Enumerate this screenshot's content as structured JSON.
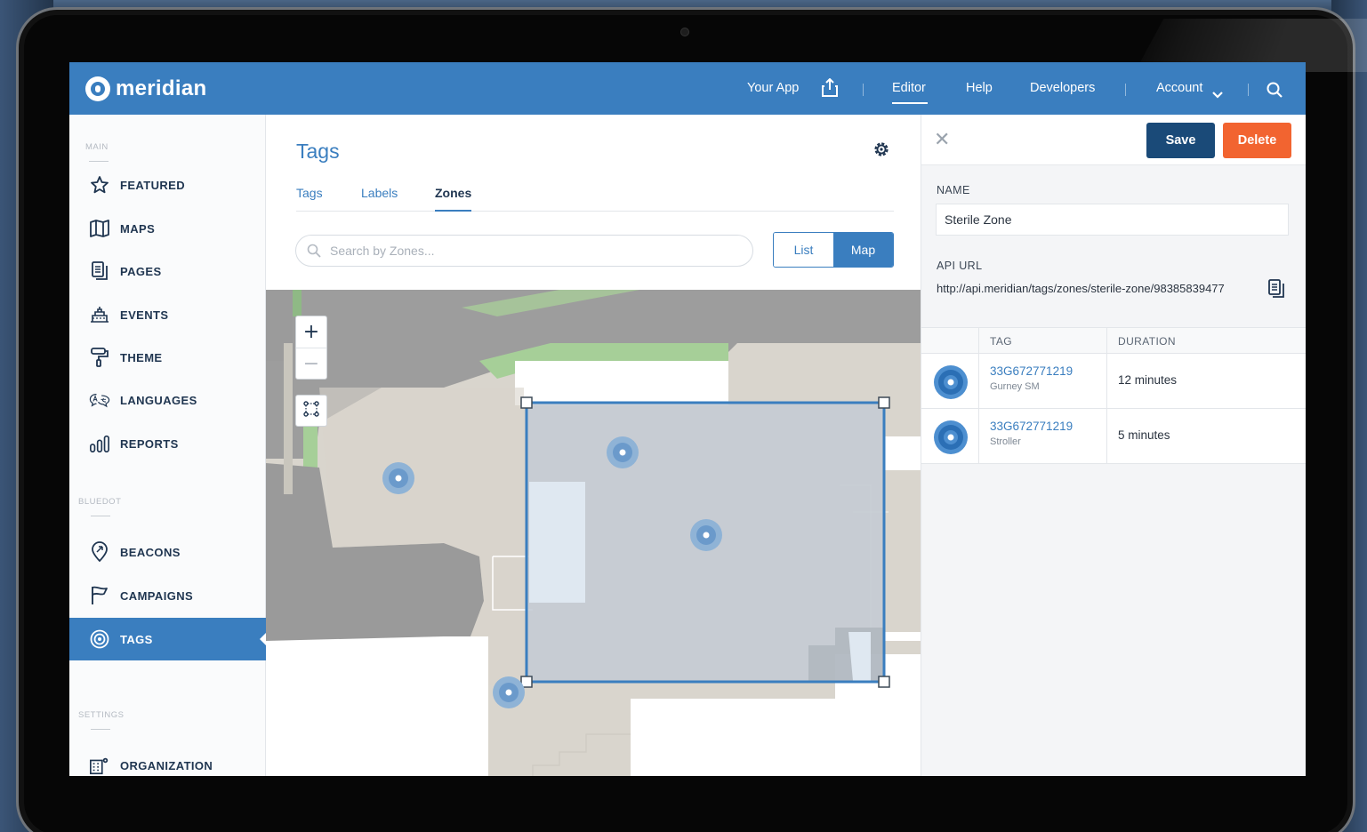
{
  "brand": {
    "name": "meridian"
  },
  "nav": {
    "your_app": "Your App",
    "editor": "Editor",
    "help": "Help",
    "developers": "Developers",
    "account": "Account"
  },
  "sidebar": {
    "sections": {
      "main": "MAIN",
      "bluedot": "BLUEDOT",
      "settings": "SETTINGS"
    },
    "items": [
      {
        "label": "FEATURED",
        "icon": "star-icon"
      },
      {
        "label": "MAPS",
        "icon": "map-icon"
      },
      {
        "label": "PAGES",
        "icon": "pages-icon"
      },
      {
        "label": "EVENTS",
        "icon": "events-icon"
      },
      {
        "label": "THEME",
        "icon": "paint-roller-icon"
      },
      {
        "label": "LANGUAGES",
        "icon": "languages-icon"
      },
      {
        "label": "REPORTS",
        "icon": "bar-chart-icon"
      },
      {
        "label": "BEACONS",
        "icon": "location-pin-icon"
      },
      {
        "label": "CAMPAIGNS",
        "icon": "flag-icon"
      },
      {
        "label": "TAGS",
        "icon": "target-icon",
        "active": true
      },
      {
        "label": "ORGANIZATION",
        "icon": "building-gear-icon"
      }
    ]
  },
  "main": {
    "title": "Tags",
    "tabs": [
      {
        "label": "Tags"
      },
      {
        "label": "Labels"
      },
      {
        "label": "Zones",
        "active": true
      }
    ],
    "search_placeholder": "Search by Zones...",
    "view_toggle": {
      "list": "List",
      "map": "Map",
      "selected": "Map"
    }
  },
  "detail": {
    "save": "Save",
    "delete": "Delete",
    "name_label": "NAME",
    "name_value": "Sterile Zone",
    "api_url_label": "API URL",
    "api_url": "http://api.meridian/tags/zones/sterile-zone/98385839477",
    "table": {
      "headers": {
        "tag": "TAG",
        "duration": "DURATION"
      },
      "rows": [
        {
          "tag_id": "33G672771219",
          "tag_name": "Gurney SM",
          "duration": "12 minutes"
        },
        {
          "tag_id": "33G672771219",
          "tag_name": "Stroller",
          "duration": "5 minutes"
        }
      ]
    }
  },
  "colors": {
    "primary": "#3a7ebf",
    "save": "#1a4a78",
    "delete": "#f26430",
    "navy_text": "#1f3550"
  }
}
